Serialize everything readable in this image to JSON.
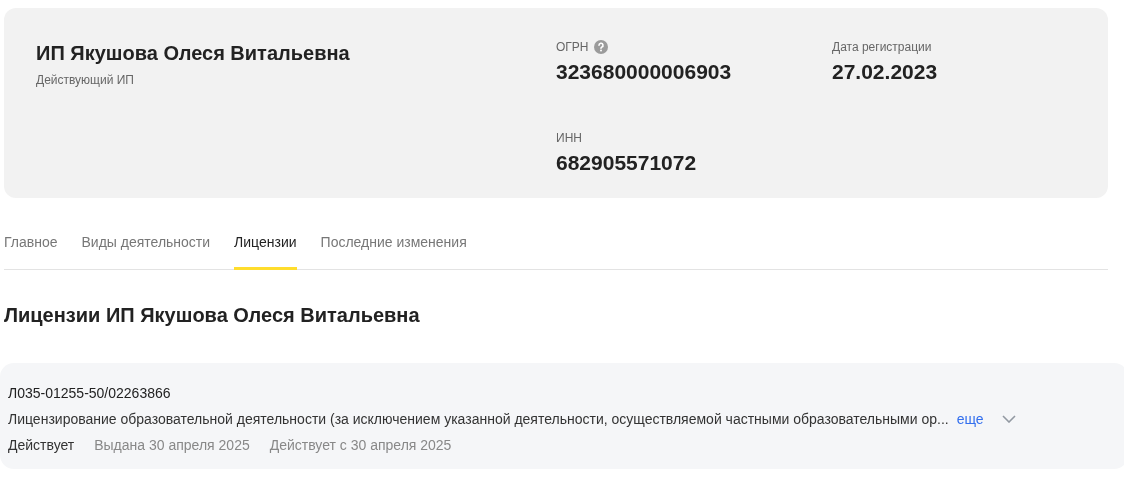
{
  "company": {
    "name": "ИП Якушова Олеся Витальевна",
    "status": "Действующий ИП"
  },
  "facts": [
    {
      "label": "ОГРН",
      "value": "323680000006903",
      "help": true
    },
    {
      "label": "Дата регистрации",
      "value": "27.02.2023"
    },
    {
      "label": "ИНН",
      "value": "682905571072"
    }
  ],
  "tabs": [
    {
      "label": "Главное",
      "selected": false
    },
    {
      "label": "Виды деятельности",
      "selected": false
    },
    {
      "label": "Лицензии",
      "selected": true
    },
    {
      "label": "Последние изменения",
      "selected": false
    }
  ],
  "heading": "Лицензии ИП Якушова Олеся Витальевна",
  "licenses": [
    {
      "number": "Л035-01255-50/02263866",
      "description": "Лицензирование образовательной деятельности (за исключением указанной деятельности, осуществляемой частными образовательными ор...",
      "more": "еще",
      "status": "Действует",
      "issued": "Выдана 30 апреля 2025",
      "valid_from": "Действует с 30 апреля 2025",
      "expanded": false
    }
  ]
}
